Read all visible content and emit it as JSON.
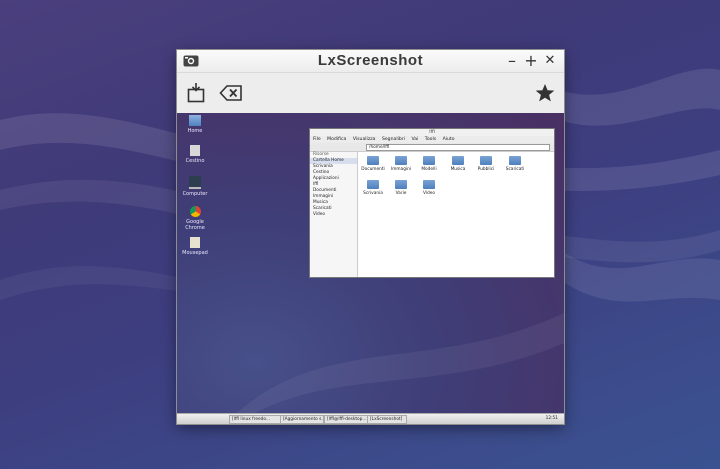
{
  "window": {
    "title": "LxScreenshot",
    "controls": {
      "minimize": "–",
      "maximize": "+",
      "close": "✕"
    }
  },
  "toolbar": {
    "save_icon": "save-screenshot-icon",
    "clear_icon": "clear-icon",
    "favorite_icon": "star-icon"
  },
  "desktop_icons": [
    {
      "label": "Home"
    },
    {
      "label": "Cestino"
    },
    {
      "label": "Computer"
    },
    {
      "label": "Google Chrome"
    },
    {
      "label": "Mousepad"
    }
  ],
  "file_manager": {
    "title": "lffl",
    "menu": [
      "File",
      "Modifica",
      "Visualizza",
      "Segnalibri",
      "Vai",
      "Tools",
      "Aiuto"
    ],
    "address": "/home/lffl",
    "sidebar_header": "Risorse",
    "sidebar_items": [
      "Cartella Home",
      "Scrivania",
      "Cestino",
      "Applicazioni",
      "lffl",
      "Documenti",
      "Immagini",
      "Musica",
      "Scaricati",
      "Video"
    ],
    "folders": [
      "Documenti",
      "Immagini",
      "Modelli",
      "Musica",
      "Pubblici",
      "Scaricati",
      "Scrivania",
      "Varie",
      "Video"
    ]
  },
  "taskbar": {
    "tasks": [
      "[lffl linux freedo...",
      "[Aggiornamento s...",
      "[lffl@lffl-desktop...",
      "[LxScreenshot]"
    ],
    "clock": "12:51"
  },
  "colors": {
    "accent": "#4e80bf",
    "desktop": "#3f3a78"
  }
}
